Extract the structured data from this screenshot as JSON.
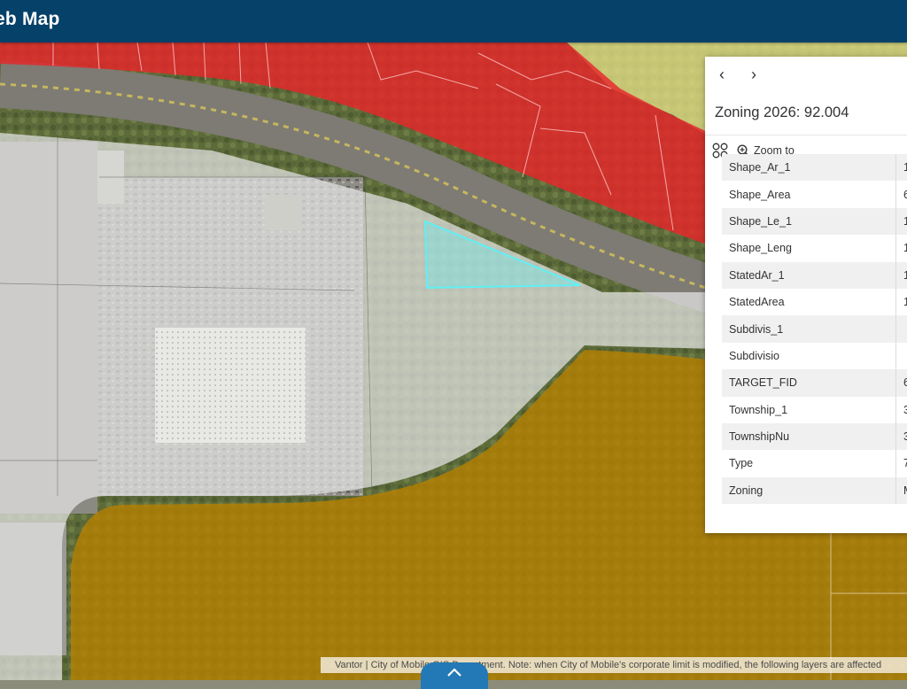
{
  "header": {
    "title": "eb Map"
  },
  "popup": {
    "prev_icon": "chevron-left-icon",
    "next_icon": "chevron-right-icon",
    "prev_glyph": "‹",
    "next_glyph": "›",
    "title": "Zoning 2026: 92.004",
    "zoom_to_label": "Zoom to",
    "attributes": [
      {
        "key": "Shape_Ar_1",
        "value": "1"
      },
      {
        "key": "Shape_Area",
        "value": "6"
      },
      {
        "key": "Shape_Le_1",
        "value": "1"
      },
      {
        "key": "Shape_Leng",
        "value": "1"
      },
      {
        "key": "StatedAr_1",
        "value": "1"
      },
      {
        "key": "StatedArea",
        "value": "1"
      },
      {
        "key": "Subdivis_1",
        "value": ""
      },
      {
        "key": "Subdivisio",
        "value": ""
      },
      {
        "key": "TARGET_FID",
        "value": "6"
      },
      {
        "key": "Township_1",
        "value": "3"
      },
      {
        "key": "TownshipNu",
        "value": "3"
      },
      {
        "key": "Type",
        "value": "7"
      },
      {
        "key": "Zoning",
        "value": "M"
      }
    ]
  },
  "attribution": "Vantor | City of Mobile GIS Department. Note: when City of Mobile's corporate limit is modified, the following layers are affected",
  "colors": {
    "header": "#064169",
    "zone_commercial": "#e8262a",
    "zone_industrial": "#b88200",
    "zone_residential": "#e9e48a",
    "zone_neutral": "#e4e4e4",
    "selected_parcel": "#5ff0f5",
    "handle": "#2379b5"
  }
}
